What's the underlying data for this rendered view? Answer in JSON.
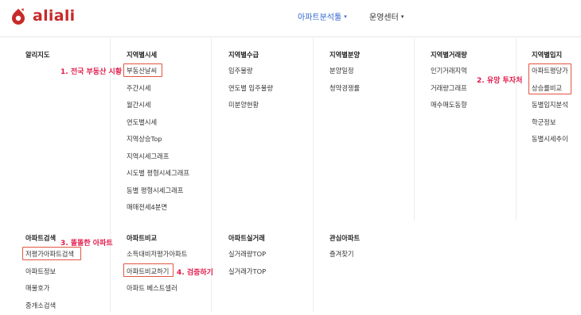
{
  "brand": {
    "name": "aliali",
    "color": "#c72a2a"
  },
  "nav": {
    "analysis_label": "아파트분석툴",
    "ops_label": "운영센터",
    "caret": "▾"
  },
  "menu_top": [
    {
      "heading": "알리지도",
      "items": []
    },
    {
      "heading": "지역별시세",
      "items": [
        "부동산날씨",
        "주간시세",
        "월간시세",
        "연도별시세",
        "지역상승Top",
        "지역시세그래프",
        "시도별 평형시세그래프",
        "동별 평형시세그래프",
        "매매전세4분면"
      ]
    },
    {
      "heading": "지역별수급",
      "items": [
        "입주물량",
        "연도별 입주물량",
        "미분양현황"
      ]
    },
    {
      "heading": "지역별분양",
      "items": [
        "분양일정",
        "청약경쟁률"
      ]
    },
    {
      "heading": "지역별거래량",
      "items": [
        "인기거래지역",
        "거래량그래프",
        "매수매도동향"
      ]
    },
    {
      "heading": "지역별입지",
      "items": [
        "아파트평당가",
        "상승률비교",
        "동별입지분석",
        "학군정보",
        "동별시세추이"
      ]
    }
  ],
  "menu_bottom": [
    {
      "heading": "아파트검색",
      "items": [
        "저평가아파트검색",
        "아파트정보",
        "매물호가",
        "중개소검색"
      ]
    },
    {
      "heading": "아파트비교",
      "items": [
        "소득대비저평가아파트",
        "아파트비교하기",
        "아파트 베스트셀러"
      ]
    },
    {
      "heading": "아파트실거래",
      "items": [
        "실거래량TOP",
        "실거래가TOP"
      ]
    },
    {
      "heading": "관심아파트",
      "items": [
        "즐겨찾기"
      ]
    }
  ],
  "annotations": {
    "a1": "1. 전국 부동산 시황",
    "a2": "2. 유망 투자처",
    "a3": "3. 똘똘한 아파트",
    "a4": "4. 검증하기"
  },
  "colors": {
    "accent_nav": "#3366cc",
    "annotation": "#e3194a",
    "highlight_box": "#e0563f"
  }
}
